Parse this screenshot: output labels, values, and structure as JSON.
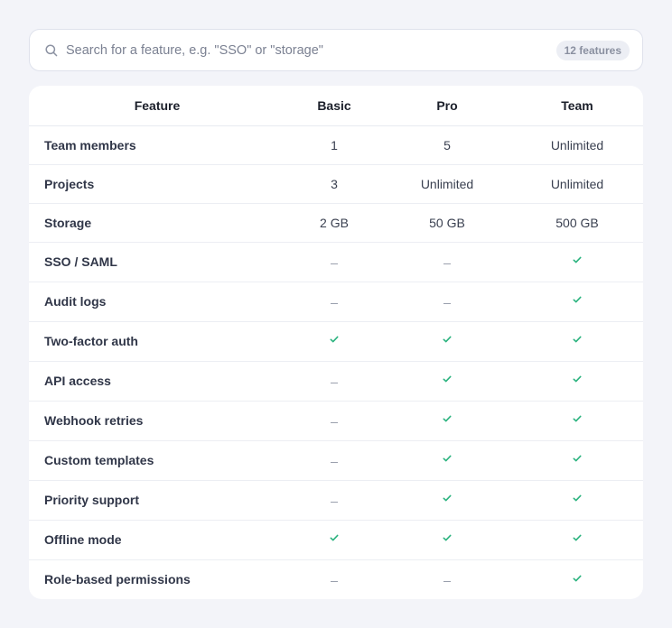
{
  "search": {
    "placeholder": "Search for a feature, e.g. \"SSO\" or \"storage\"",
    "value": "",
    "count_badge": "12 features"
  },
  "table": {
    "headers": [
      "Feature",
      "Basic",
      "Pro",
      "Team"
    ],
    "rows": [
      {
        "feature": "Team members",
        "basic": "1",
        "pro": "5",
        "team": "Unlimited"
      },
      {
        "feature": "Projects",
        "basic": "3",
        "pro": "Unlimited",
        "team": "Unlimited"
      },
      {
        "feature": "Storage",
        "basic": "2 GB",
        "pro": "50 GB",
        "team": "500 GB"
      },
      {
        "feature": "SSO / SAML",
        "basic": false,
        "pro": false,
        "team": true
      },
      {
        "feature": "Audit logs",
        "basic": false,
        "pro": false,
        "team": true
      },
      {
        "feature": "Two-factor auth",
        "basic": true,
        "pro": true,
        "team": true
      },
      {
        "feature": "API access",
        "basic": false,
        "pro": true,
        "team": true
      },
      {
        "feature": "Webhook retries",
        "basic": false,
        "pro": true,
        "team": true
      },
      {
        "feature": "Custom templates",
        "basic": false,
        "pro": true,
        "team": true
      },
      {
        "feature": "Priority support",
        "basic": false,
        "pro": true,
        "team": true
      },
      {
        "feature": "Offline mode",
        "basic": true,
        "pro": true,
        "team": true
      },
      {
        "feature": "Role-based permissions",
        "basic": false,
        "pro": false,
        "team": true
      }
    ]
  },
  "icons": {
    "included": "check-icon",
    "not_included": "dash-icon",
    "search": "search-icon"
  },
  "colors": {
    "page_background": "#f3f4f9",
    "check": "#2bb37f",
    "dash": "#9aa0ad",
    "badge_background": "#eceef4",
    "badge_text": "#8a90a0"
  }
}
